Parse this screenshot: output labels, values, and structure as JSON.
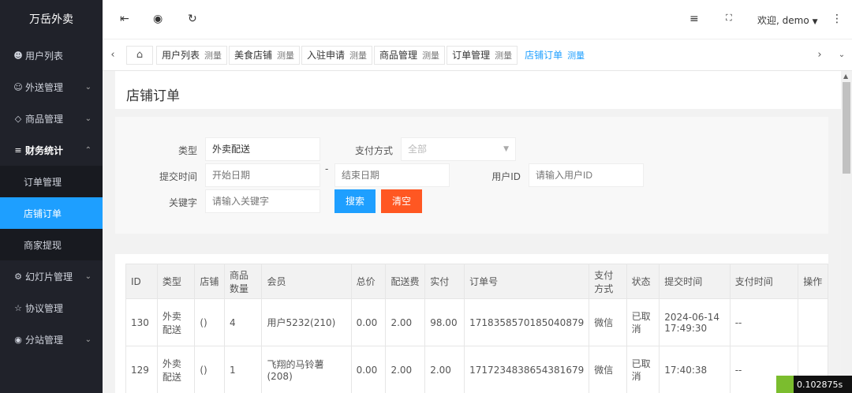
{
  "app_title": "万岳外卖",
  "sidebar": {
    "items": [
      {
        "icon": "user-icon",
        "label": "用户列表"
      },
      {
        "icon": "delivery-icon",
        "label": "外送管理"
      },
      {
        "icon": "diamond-icon",
        "label": "商品管理"
      },
      {
        "icon": "finance-icon",
        "label": "财务统计"
      },
      {
        "label": "订单管理"
      },
      {
        "label": "店铺订单"
      },
      {
        "label": "商家提现"
      },
      {
        "icon": "slideshow-icon",
        "label": "幻灯片管理"
      },
      {
        "icon": "star-icon",
        "label": "协议管理"
      },
      {
        "icon": "globe-icon",
        "label": "分站管理"
      }
    ]
  },
  "header": {
    "user_text": "欢迎, demo"
  },
  "tabs": [
    {
      "label": "用户列表",
      "sub": "测量"
    },
    {
      "label": "美食店铺",
      "sub": "测量"
    },
    {
      "label": "入驻申请",
      "sub": "测量"
    },
    {
      "label": "商品管理",
      "sub": "测量"
    },
    {
      "label": "订单管理",
      "sub": "测量"
    },
    {
      "label": "店铺订单",
      "sub": "测量"
    }
  ],
  "page_title": "店铺订单",
  "form": {
    "type_label": "类型",
    "type_value": "外卖配送",
    "pay_label": "支付方式",
    "pay_value": "全部",
    "time_label": "提交时间",
    "start_placeholder": "开始日期",
    "dash": "-",
    "end_placeholder": "结束日期",
    "uid_label": "用户ID",
    "uid_placeholder": "请输入用户ID",
    "keyword_label": "关键字",
    "keyword_placeholder": "请输入关键字",
    "search_btn": "搜索",
    "clear_btn": "清空"
  },
  "table": {
    "headers": [
      "ID",
      "类型",
      "店铺",
      "商品数量",
      "会员",
      "总价",
      "配送费",
      "实付",
      "订单号",
      "支付方式",
      "状态",
      "提交时间",
      "支付时间",
      "操作"
    ],
    "rows": [
      [
        "130",
        "外卖配送",
        "()",
        "4",
        "用户5232(210)",
        "0.00",
        "2.00",
        "98.00",
        "1718358570185040879",
        "微信",
        "已取消",
        "2024-06-14 17:49:30",
        "--",
        ""
      ],
      [
        "129",
        "外卖配送",
        "()",
        "1",
        "飞翔的马铃薯(208)",
        "0.00",
        "2.00",
        "2.00",
        "1717234838654381679",
        "微信",
        "已取消",
        "17:40:38",
        "--",
        ""
      ]
    ]
  },
  "timer": "0.102875s"
}
